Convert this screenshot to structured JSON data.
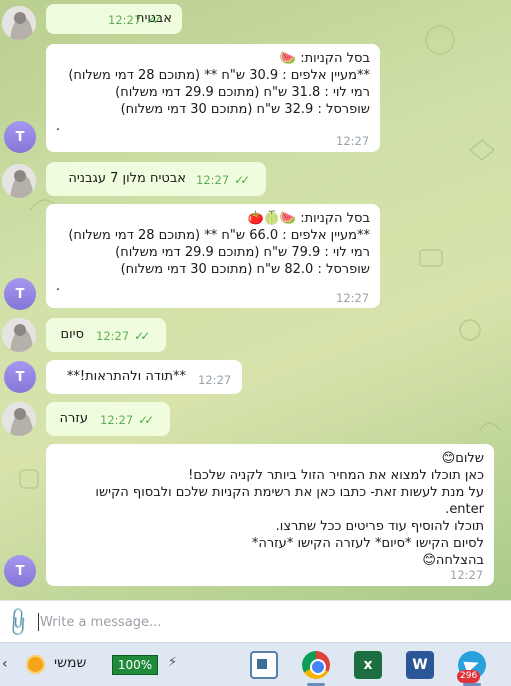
{
  "messages": [
    {
      "from": "user",
      "text": "אבטיח",
      "time": "12:27"
    },
    {
      "from": "bot",
      "lines": [
        "בסל הקניות: 🍉",
        "**מעיין אלפים : 30.9 ש\"ח ** (מתוכם 28 דמי משלוח)",
        "רמי לוי : 31.8 ש\"ח  (מתוכם 29.9 דמי משלוח)",
        "שופרסל : 32.9 ש\"ח  (מתוכם 30 דמי משלוח)",
        "."
      ],
      "time": "12:27",
      "avatar": "T"
    },
    {
      "from": "user",
      "text": "אבטיח מלון 7 עגבניה",
      "time": "12:27"
    },
    {
      "from": "bot",
      "lines": [
        "בסל הקניות: 🍉🍈🍅",
        "**מעיין אלפים : 66.0 ש\"ח ** (מתוכם 28 דמי משלוח)",
        "רמי לוי : 79.9 ש\"ח  (מתוכם 29.9 דמי משלוח)",
        "שופרסל : 82.0 ש\"ח  (מתוכם 30 דמי משלוח)",
        "."
      ],
      "time": "12:27",
      "avatar": "T"
    },
    {
      "from": "user",
      "text": "סיום",
      "time": "12:27"
    },
    {
      "from": "bot",
      "lines": [
        "**תודה ולהתראות!**"
      ],
      "time": "12:27",
      "avatar": "T"
    },
    {
      "from": "user",
      "text": "עזרה",
      "time": "12:27"
    },
    {
      "from": "bot",
      "lines": [
        "שלום😊",
        "כאן תוכלו למצוא את המחיר הזול ביותר לקניה שלכם!",
        "על מנת לעשות זאת- כתבו כאן את רשימת הקניות שלכם ולבסוף הקישו",
        "enter.",
        "תוכלו להוסיף עוד פריטים ככל שתרצו.",
        "לסיום הקישו *סיום* לעזרה הקישו *עזרה*",
        "בהצלחה😊"
      ],
      "time": "12:27",
      "avatar": "T"
    }
  ],
  "composer": {
    "placeholder": "Write a message..."
  },
  "taskbar": {
    "weather_label": "שמשי",
    "battery": "100%",
    "telegram_badge": "296",
    "apps": [
      "photos-icon",
      "chrome-icon",
      "excel-icon",
      "word-icon",
      "telegram-icon"
    ],
    "excel_letter": "x",
    "word_letter": "W"
  },
  "colors": {
    "incoming": "#ffffff",
    "outgoing": "#effdde",
    "avatar_t": "#8f80e3",
    "accent_green": "#5fad56"
  }
}
